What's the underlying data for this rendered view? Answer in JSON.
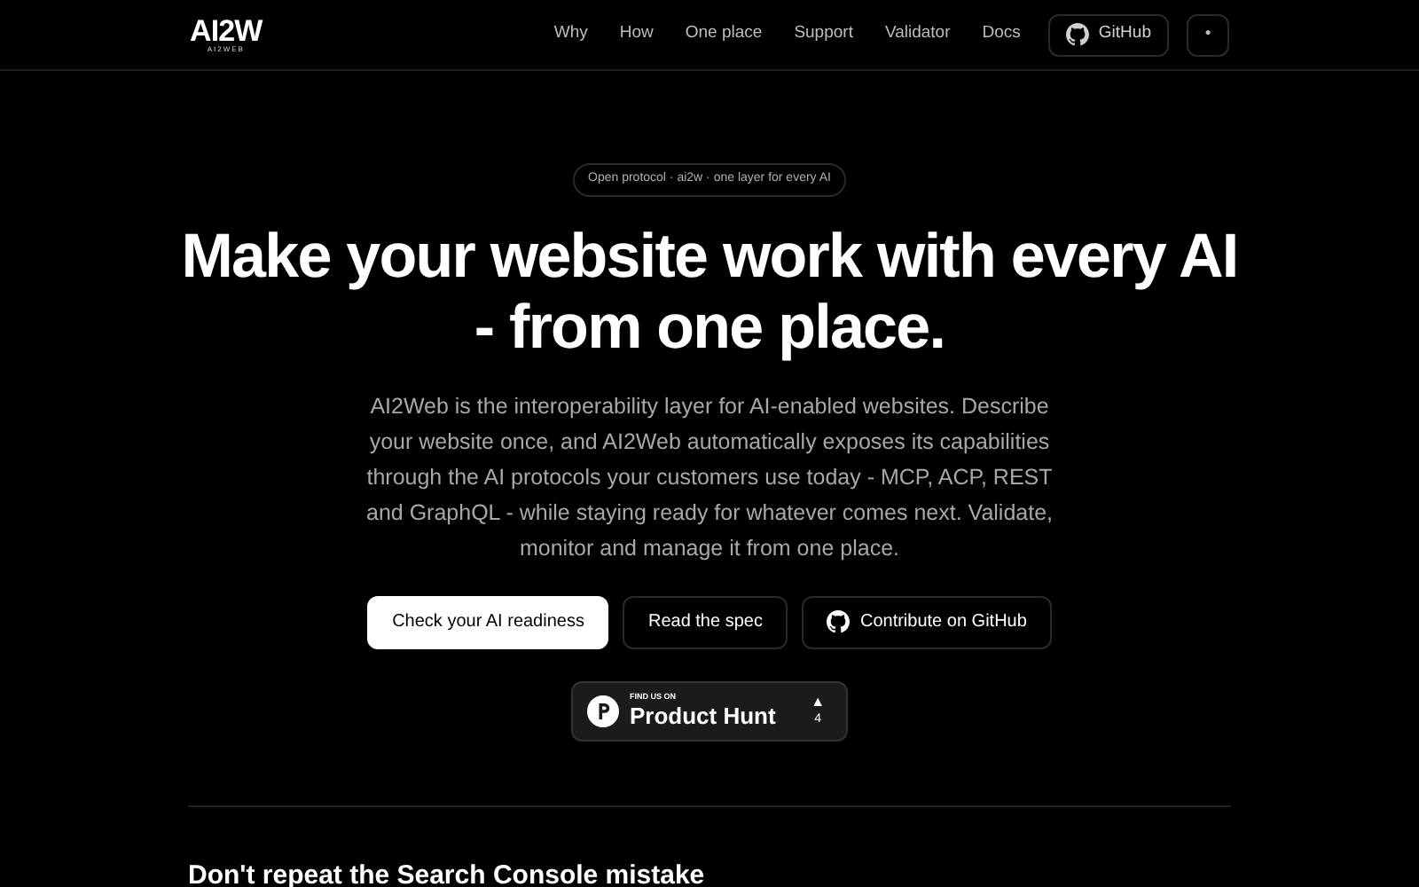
{
  "header": {
    "logo": "AI2W",
    "logo_sub": "AI2WEB",
    "nav": [
      "Why",
      "How",
      "One place",
      "Support",
      "Validator",
      "Docs"
    ],
    "github": "GitHub",
    "theme_toggle": "●"
  },
  "hero": {
    "badge": "Open protocol · ai2w · one layer for every AI",
    "title": "Make your website work with every AI - from one place.",
    "lead": "AI2Web is the interoperability layer for AI-enabled websites. Describe your website once, and AI2Web automatically exposes its capabilities through the AI protocols your customers use today - MCP, ACP, REST and GraphQL - while staying ready for whatever comes next. Validate, monitor and manage it from one place.",
    "buttons": [
      {
        "label": "Check your AI readiness",
        "kind": "primary"
      },
      {
        "label": "Read the spec",
        "kind": "outline"
      },
      {
        "label": "Contribute on GitHub",
        "kind": "github"
      }
    ],
    "product_hunt": {
      "kicker": "FIND US ON",
      "name": "Product Hunt",
      "arrow": "▲",
      "count": "4"
    }
  },
  "section": {
    "title": "Don't repeat the Search Console mistake"
  }
}
